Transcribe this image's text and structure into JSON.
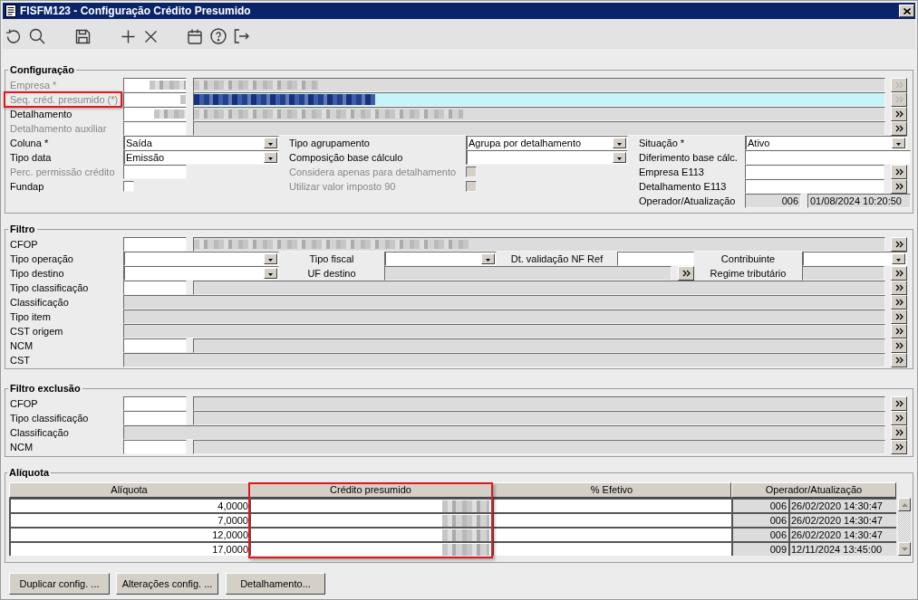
{
  "window": {
    "title": "FISFM123 - Configuração Crédito Presumido"
  },
  "configuracao": {
    "title": "Configuração",
    "lookups": [
      {
        "label": "Empresa *",
        "disabled": true,
        "highlighted": false,
        "code": {
          "redacted": true
        },
        "description": {
          "redacted": true,
          "focused": false
        },
        "button_disabled": true
      },
      {
        "label": "Seq. créd. presumido (*)",
        "disabled": true,
        "highlighted": true,
        "code": {
          "redacted": true
        },
        "description": {
          "redacted": true,
          "focused": true
        },
        "button_disabled": true
      },
      {
        "label": "Detalhamento",
        "disabled": false,
        "highlighted": false,
        "code": {
          "redacted": true
        },
        "description": {
          "redacted": true,
          "focused": false
        },
        "button_disabled": false
      },
      {
        "label": "Detalhamento auxiliar",
        "disabled": true,
        "highlighted": false,
        "description": {
          "focused": false
        },
        "button_disabled": false
      }
    ],
    "columns": [
      [
        {
          "kind": "combo",
          "label": "Coluna *",
          "disabled": false,
          "value": "Saída"
        },
        {
          "kind": "combo",
          "label": "Tipo data",
          "disabled": false,
          "value": "Emissão"
        },
        {
          "kind": "input",
          "label": "Perc. permissão crédito",
          "disabled": true
        },
        {
          "kind": "checkbox",
          "label": "Fundap",
          "disabled": false,
          "checked": false
        }
      ],
      [
        {
          "kind": "combo",
          "label": "Tipo agrupamento",
          "disabled": false,
          "value": "Agrupa por detalhamento"
        },
        {
          "kind": "combo",
          "label": "Composição base cálculo",
          "disabled": false
        },
        {
          "kind": "checkbox",
          "label": "Considera apenas para detalhamento",
          "disabled": true,
          "checked": false
        },
        {
          "kind": "checkbox",
          "label": "Utilizar valor imposto 90",
          "disabled": true,
          "checked": false
        }
      ],
      [
        {
          "kind": "combo",
          "label": "Situação *",
          "disabled": false,
          "value": "Ativo"
        },
        {
          "kind": "input",
          "label": "Diferimento base cálc.",
          "disabled": false
        },
        {
          "kind": "lookup_input",
          "label": "Empresa E113",
          "disabled": false
        },
        {
          "kind": "lookup_input",
          "label": "Detalhamento E113",
          "disabled": false
        },
        {
          "kind": "readonly_pair",
          "label": "Operador/Atualização",
          "disabled": false,
          "values": [
            "006",
            "01/08/2024 10:20:50"
          ]
        }
      ]
    ]
  },
  "filtro": {
    "title": "Filtro",
    "rows": [
      {
        "kind": "lookup",
        "label": "CFOP",
        "description": {
          "redacted": true
        }
      },
      {
        "kind": "multi",
        "label": "Tipo operação",
        "pairs": [
          {
            "label": "Tipo fiscal",
            "kind": "combo"
          },
          {
            "label": "Dt. validação NF Ref",
            "kind": "input"
          },
          {
            "label": "Contribuinte",
            "kind": "combo"
          }
        ]
      },
      {
        "kind": "multi",
        "label": "Tipo destino",
        "pairs": [
          {
            "label": "UF destino",
            "kind": "readonly_lookup"
          },
          {
            "label": "Regime tributário",
            "kind": "readonly_lookup"
          }
        ]
      },
      {
        "kind": "lookup",
        "label": "Tipo classificação"
      },
      {
        "kind": "wide_lookup",
        "label": "Classificação"
      },
      {
        "kind": "wide_lookup",
        "label": "Tipo item"
      },
      {
        "kind": "wide_lookup",
        "label": "CST origem"
      },
      {
        "kind": "lookup",
        "label": "NCM"
      },
      {
        "kind": "wide_lookup",
        "label": "CST"
      }
    ]
  },
  "filtro_exclusao": {
    "title": "Filtro exclusão",
    "rows": [
      {
        "kind": "lookup",
        "label": "CFOP"
      },
      {
        "kind": "lookup",
        "label": "Tipo classificação"
      },
      {
        "kind": "wide_lookup",
        "label": "Classificação"
      },
      {
        "kind": "lookup",
        "label": "NCM"
      }
    ]
  },
  "aliquota": {
    "title": "Alíquota",
    "columns": [
      {
        "label": "Alíquota",
        "highlighted": false
      },
      {
        "label": "Crédito presumido",
        "highlighted": true
      },
      {
        "label": "% Efetivo",
        "highlighted": false
      },
      {
        "label": "Operador/Atualização",
        "highlighted": false
      }
    ],
    "rows": [
      {
        "aliquota": "4,0000",
        "credito_presumido": {
          "redacted": true
        },
        "operador": "006",
        "atualizacao": "26/02/2020 14:30:47"
      },
      {
        "aliquota": "7,0000",
        "credito_presumido": {
          "redacted": true
        },
        "operador": "006",
        "atualizacao": "26/02/2020 14:30:47"
      },
      {
        "aliquota": "12,0000",
        "credito_presumido": {
          "redacted": true
        },
        "operador": "006",
        "atualizacao": "26/02/2020 14:30:47"
      },
      {
        "aliquota": "17,0000",
        "credito_presumido": {
          "redacted": true
        },
        "operador": "009",
        "atualizacao": "12/11/2024 13:45:00"
      }
    ]
  },
  "buttons": [
    "Duplicar config. ...",
    "Alterações config. ...",
    "Detalhamento..."
  ]
}
